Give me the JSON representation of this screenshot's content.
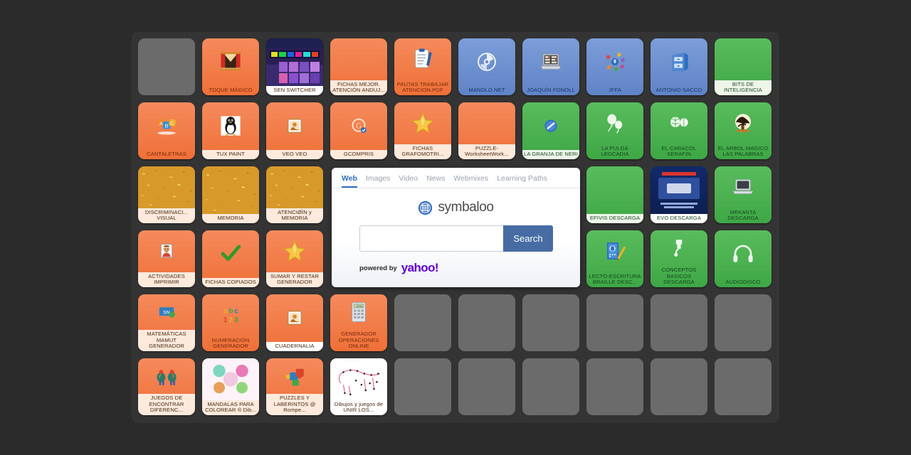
{
  "colors": {
    "page_background": "#2b2b2b",
    "panel_background": "#343434",
    "tile_orange": "#f07a45",
    "tile_blue": "#6a8fd0",
    "tile_green": "#4caf50",
    "tile_empty_gray": "#6b6b6b",
    "label_band_cream": "#fdeadd",
    "accent_blue": "#2f6cc0",
    "search_button_blue": "#476ca4",
    "yahoo_purple": "#6001d2"
  },
  "search_widget": {
    "tabs": [
      {
        "label": "Web",
        "active": true
      },
      {
        "label": "Images",
        "active": false
      },
      {
        "label": "Video",
        "active": false
      },
      {
        "label": "News",
        "active": false
      },
      {
        "label": "Webmixes",
        "active": false
      },
      {
        "label": "Learning Paths",
        "active": false
      }
    ],
    "logo_text": "symbaloo",
    "input_value": "",
    "input_placeholder": "",
    "submit_label": "Search",
    "powered_by_label": "powered by",
    "provider_label": "yahoo!"
  },
  "grid": {
    "columns": 10,
    "rows": 6,
    "tiles": [
      {
        "label": "",
        "color": "empty",
        "icon": ""
      },
      {
        "label": "TOQUE MÁGICO",
        "color": "orange",
        "icon": "curtain-stage-icon"
      },
      {
        "label": "SEN SWITCHER",
        "color": "dark",
        "icon": "sen-switcher-screenshot",
        "band": "bandw"
      },
      {
        "label": "FICHAS MEJOR. ATENCIÓN ANDUJ...",
        "color": "orange",
        "icon": "",
        "band": "band"
      },
      {
        "label": "PAUTAS TRABAJAR ATENCION.PDF",
        "color": "orange",
        "icon": "clipboard-pen-icon"
      },
      {
        "label": "MANOLO.NET",
        "color": "blue",
        "icon": "cd-disc-icon"
      },
      {
        "label": "JOAQUÍN FONOLL",
        "color": "blue",
        "icon": "laptop-chart-icon"
      },
      {
        "label": "JFFA",
        "color": "blue",
        "icon": "network-nodes-icon"
      },
      {
        "label": "ANTONIO SACCO",
        "color": "blue",
        "icon": "file-cabinet-icon"
      },
      {
        "label": "BITS DE INTELIGENCIA",
        "color": "green",
        "icon": "",
        "band": "band2"
      },
      {
        "label": "CANTALETRAS",
        "color": "orange",
        "icon": "abc-blocks-icon"
      },
      {
        "label": "TUX PAINT",
        "color": "orange",
        "icon": "tux-penguin-icon",
        "band": "band"
      },
      {
        "label": "VEO VEO",
        "color": "orange",
        "icon": "picture-frame-icon",
        "band": "band"
      },
      {
        "label": "GCOMPRIS",
        "color": "orange",
        "icon": "gcompris-icon",
        "band": "band"
      },
      {
        "label": "FICHAS GRAFOMOTRI...",
        "color": "orange",
        "icon": "gold-star-icon",
        "band": "band"
      },
      {
        "label": "PUZZLE-WorksheetWork...",
        "color": "orange",
        "icon": "",
        "band": "band"
      },
      {
        "label": "LA GRANJA DE NERI",
        "color": "green",
        "icon": "blue-badge-icon",
        "band": "band2"
      },
      {
        "label": "LA PULGA LEOCADIA",
        "color": "green",
        "icon": "balloons-icon"
      },
      {
        "label": "EL CARACOL SERAFIN",
        "color": "green",
        "icon": "white-leaves-icon"
      },
      {
        "label": "EL ARBOL MAGICO LAS PALABRAS",
        "color": "green",
        "icon": "magic-tree-icon"
      },
      {
        "label": "DISCRIMINACI... VISUAL",
        "color": "orange",
        "icon": "pasta-photo",
        "band": "band"
      },
      {
        "label": "MEMORIA",
        "color": "orange",
        "icon": "pasta-photo",
        "band": "band"
      },
      {
        "label": "ATENCIØÌN y MEMORIA",
        "color": "orange",
        "icon": "pasta-photo",
        "band": "band"
      },
      {
        "label": "",
        "color": "covered",
        "icon": ""
      },
      {
        "label": "",
        "color": "covered",
        "icon": ""
      },
      {
        "label": "",
        "color": "covered",
        "icon": ""
      },
      {
        "label": "",
        "color": "covered",
        "icon": ""
      },
      {
        "label": "EFIVIS DESCARGA",
        "color": "green",
        "icon": "",
        "band": "band2"
      },
      {
        "label": "EVO DESCARGA",
        "color": "green",
        "icon": "evo-book-cover",
        "band": "bandw"
      },
      {
        "label": "MEKANTA DESCARGA",
        "color": "green",
        "icon": "laptop-icon"
      },
      {
        "label": "ACTIVIDADES IMPRIMIR",
        "color": "orange",
        "icon": "face-thumbnail-icon",
        "band": "band"
      },
      {
        "label": "FICHAS COPIADOS",
        "color": "orange",
        "icon": "green-check-icon",
        "band": "band"
      },
      {
        "label": "SUMAR Y RESTAR GENERADOR",
        "color": "orange",
        "icon": "gold-star-icon",
        "band": "band"
      },
      {
        "label": "",
        "color": "covered",
        "icon": ""
      },
      {
        "label": "",
        "color": "covered",
        "icon": ""
      },
      {
        "label": "",
        "color": "covered",
        "icon": ""
      },
      {
        "label": "",
        "color": "covered",
        "icon": ""
      },
      {
        "label": "LECTO-ESCRITURA BRAILLE DESC...",
        "color": "green",
        "icon": "braille-book-pencil-icon"
      },
      {
        "label": "CONCEPTOS BASICOS DESCARGA",
        "color": "green",
        "icon": "faucet-icon"
      },
      {
        "label": "AUDIODISCO",
        "color": "green",
        "icon": "headphones-icon"
      },
      {
        "label": "MATEMÁTICAS MAMUT GENERADOR",
        "color": "orange",
        "icon": "mamut-logo-icon",
        "band": "band"
      },
      {
        "label": "NUMERACIÓN GENERADOR",
        "color": "orange",
        "icon": "abc123-icon"
      },
      {
        "label": "CUADERNALIA",
        "color": "orange",
        "icon": "picture-frame-icon",
        "band": "bandw"
      },
      {
        "label": "GENERADOR OPERACIONES ONLINE",
        "color": "orange",
        "icon": "calculator-icon"
      },
      {
        "label": "",
        "color": "empty",
        "icon": ""
      },
      {
        "label": "",
        "color": "empty",
        "icon": ""
      },
      {
        "label": "",
        "color": "empty",
        "icon": ""
      },
      {
        "label": "",
        "color": "empty",
        "icon": ""
      },
      {
        "label": "",
        "color": "empty",
        "icon": ""
      },
      {
        "label": "",
        "color": "empty",
        "icon": ""
      },
      {
        "label": "JUEGOS DE ENCONTRAR DIFERENC...",
        "color": "orange",
        "icon": "elephants-icon",
        "band": "band"
      },
      {
        "label": "MANDALAS PARA COLOREAR ® Dib...",
        "color": "orange",
        "icon": "mandala-thumbnail",
        "band": "band"
      },
      {
        "label": "PUZZLES Y LABERINTOS @ Rompe...",
        "color": "orange",
        "icon": "jigsaw-pieces-icon",
        "band": "band"
      },
      {
        "label": "Dibujos y juegos de UNIR LOS...",
        "color": "orange",
        "icon": "connect-dots-thumbnail",
        "band": "bandw"
      },
      {
        "label": "",
        "color": "empty",
        "icon": ""
      },
      {
        "label": "",
        "color": "empty",
        "icon": ""
      },
      {
        "label": "",
        "color": "empty",
        "icon": ""
      },
      {
        "label": "",
        "color": "empty",
        "icon": ""
      },
      {
        "label": "",
        "color": "empty",
        "icon": ""
      },
      {
        "label": "",
        "color": "empty",
        "icon": ""
      }
    ]
  }
}
